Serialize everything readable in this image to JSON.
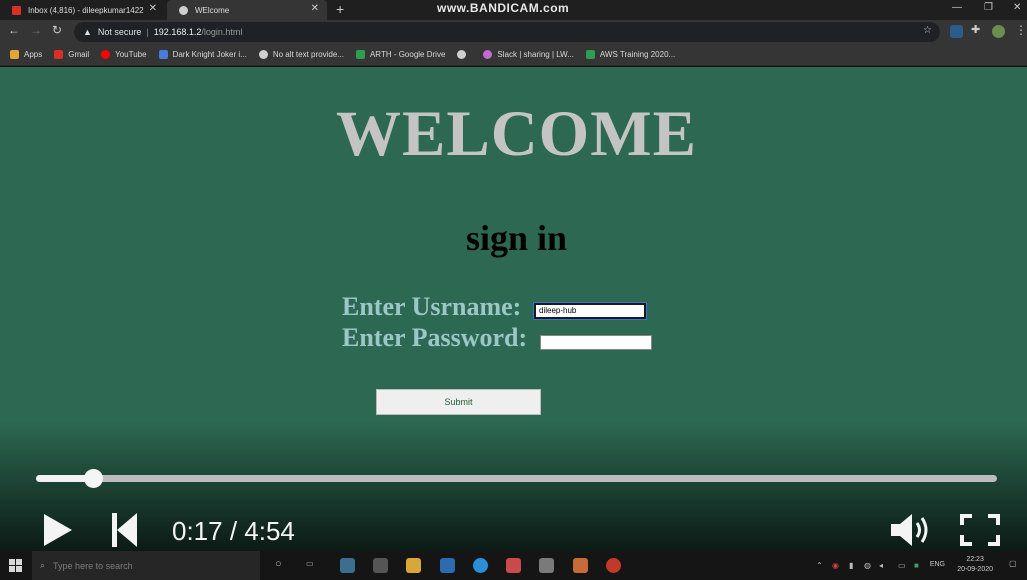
{
  "browser": {
    "tabs": [
      {
        "title": "Inbox (4,816) - dileepkumar1422",
        "active": false
      },
      {
        "title": "WElcome",
        "active": true
      }
    ],
    "new_tab_label": "+",
    "recorder_watermark": "www.BANDICAM.com",
    "address": {
      "security_label": "Not secure",
      "separator": "|",
      "host": "192.168.1.2",
      "path": "/login.html"
    },
    "bookmarks": [
      {
        "label": "Apps",
        "icon": "apps-grid-icon",
        "color": "#e5a33d"
      },
      {
        "label": "Gmail",
        "icon": "gmail-icon",
        "color": "#d93025"
      },
      {
        "label": "YouTube",
        "icon": "youtube-icon",
        "color": "#ff0000"
      },
      {
        "label": "Dark Knight Joker i...",
        "icon": "wallpaper-site-icon",
        "color": "#4a7bd6"
      },
      {
        "label": "No alt text provide...",
        "icon": "globe-icon",
        "color": "#cfcfcf"
      },
      {
        "label": "ARTH - Google Drive",
        "icon": "google-drive-icon",
        "color": "#2d9e4e"
      },
      {
        "label": "",
        "icon": "globe-icon",
        "color": "#cfcfcf"
      },
      {
        "label": "Slack | sharing | LW...",
        "icon": "slack-icon",
        "color": "#c46ad6"
      },
      {
        "label": "AWS Training 2020...",
        "icon": "google-drive-icon",
        "color": "#2d9e4e"
      }
    ]
  },
  "page": {
    "heading": "WELCOME",
    "subheading": "sign in",
    "username_label": "Enter Usrname:",
    "username_value": "dileep-hub",
    "password_label": "Enter Password:",
    "password_value": "",
    "submit_label": "Submit",
    "background_color": "#2d6853"
  },
  "player": {
    "progress_fraction": 0.059,
    "time_text": "0:17 / 4:54",
    "controls": [
      "play-icon",
      "previous-icon",
      "volume-icon",
      "fullscreen-icon"
    ]
  },
  "taskbar": {
    "search_placeholder": "Type here to search",
    "language": "ENG",
    "clock_time": "22:23",
    "clock_date": "20-09-2020"
  }
}
